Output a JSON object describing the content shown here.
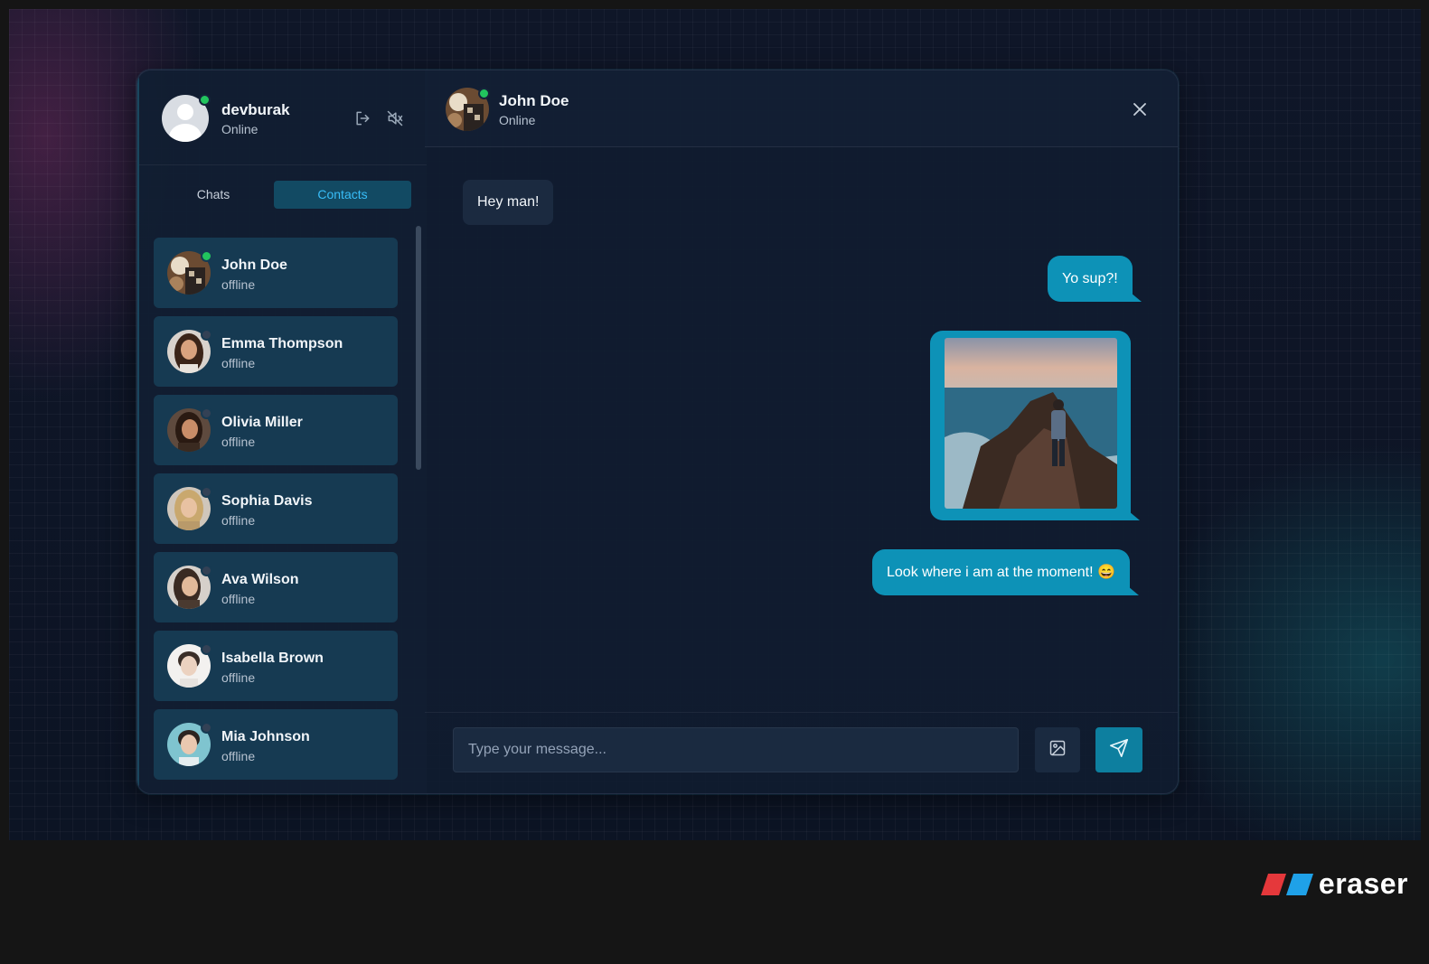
{
  "me": {
    "name": "devburak",
    "status": "Online"
  },
  "tabs": {
    "chats": "Chats",
    "contacts": "Contacts",
    "active": "contacts"
  },
  "contacts": [
    {
      "name": "John Doe",
      "status": "offline",
      "online": true
    },
    {
      "name": "Emma Thompson",
      "status": "offline",
      "online": false
    },
    {
      "name": "Olivia Miller",
      "status": "offline",
      "online": false
    },
    {
      "name": "Sophia Davis",
      "status": "offline",
      "online": false
    },
    {
      "name": "Ava Wilson",
      "status": "offline",
      "online": false
    },
    {
      "name": "Isabella Brown",
      "status": "offline",
      "online": false
    },
    {
      "name": "Mia Johnson",
      "status": "offline",
      "online": false
    }
  ],
  "chat": {
    "contact_name": "John Doe",
    "contact_status": "Online",
    "messages": [
      {
        "direction": "incoming",
        "text": "Hey man!"
      },
      {
        "direction": "outgoing",
        "text": "Yo sup?!"
      },
      {
        "direction": "outgoing",
        "type": "image"
      },
      {
        "direction": "outgoing",
        "text": "Look where i am at the moment! 😄"
      }
    ]
  },
  "composer": {
    "placeholder": "Type your message..."
  },
  "icons": {
    "logout": "logout-icon",
    "sound": "volume-off-icon",
    "close": "close-icon",
    "image": "image-icon",
    "send": "send-icon"
  },
  "colors": {
    "accent": "#0d92b7",
    "online": "#22c55e",
    "tab_active_text": "#38bdf8"
  },
  "brand": {
    "name": "eraser"
  }
}
